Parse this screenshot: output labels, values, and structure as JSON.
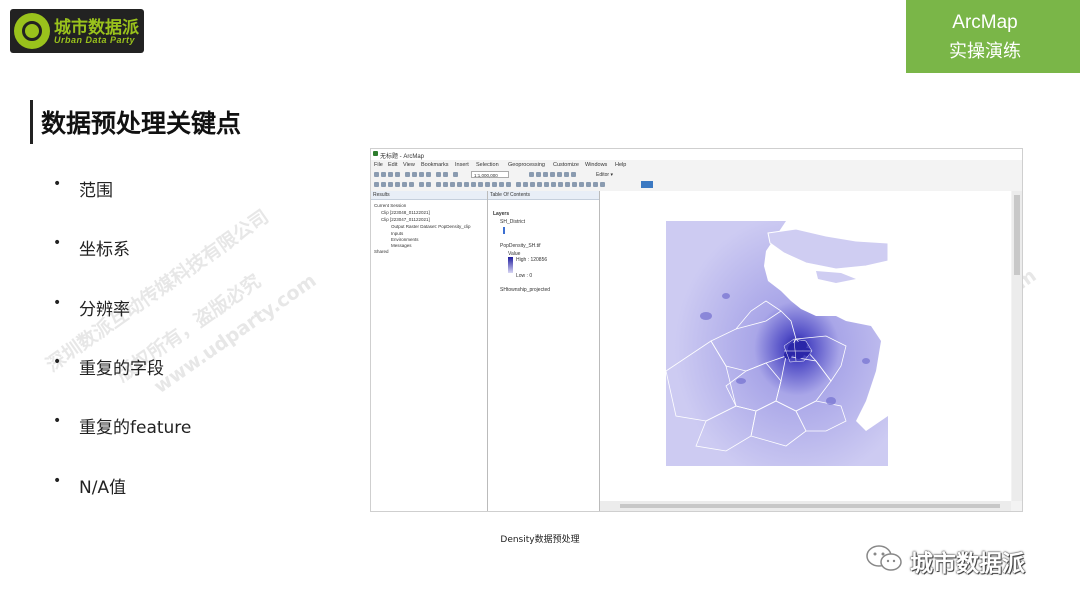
{
  "brand": {
    "name": "城市数据派",
    "sub": "Urban Data Party"
  },
  "tag": {
    "line1": "ArcMap",
    "line2": "实操演练"
  },
  "heading": "数据预处理关键点",
  "bullets": [
    {
      "symbol": "•",
      "text": "范围"
    },
    {
      "symbol": "•",
      "text": "坐标系"
    },
    {
      "symbol": "•",
      "text": "分辨率"
    },
    {
      "symbol": "•",
      "text": "重复的字段"
    },
    {
      "symbol": "•",
      "text": "重复的feature"
    },
    {
      "symbol": "•",
      "text": "N/A值"
    }
  ],
  "arcmap": {
    "title": "无标题 - ArcMap",
    "menu": [
      "File",
      "Edit",
      "View",
      "Bookmarks",
      "Insert",
      "Selection",
      "Geoprocessing",
      "Customize",
      "Windows",
      "Help"
    ],
    "scale": "1:1,000,000",
    "editor": "Editor ▾",
    "results_panel": {
      "header": "Results",
      "items": [
        "Current Session",
        "Clip [223048_01122021]",
        "Clip [223047_01122021]",
        "Output Raster Dataset: PopDensity_clip",
        "Inputs",
        "Environments",
        "Messages",
        "Shared"
      ]
    },
    "toc": {
      "header": "Table Of Contents",
      "layers_label": "Layers",
      "layer1": "SH_District",
      "layer2": "PopDensity_SH.tif",
      "value_label": "Value",
      "high": "High : 120856",
      "low": "Low : 0",
      "layer3": "SHtownship_projected"
    }
  },
  "caption": "Density数据预处理",
  "wechat": {
    "name": "城市数据派"
  },
  "watermark": {
    "line1": "深圳数派互动传媒科技有限公司",
    "line2": "版权所有，盗版必究",
    "line3": "www.udparty.com"
  },
  "colors": {
    "accent_green": "#7ab648",
    "logo_green": "#9ac21c",
    "density_low": "#cfcdf2",
    "density_high": "#1e1b9e"
  }
}
